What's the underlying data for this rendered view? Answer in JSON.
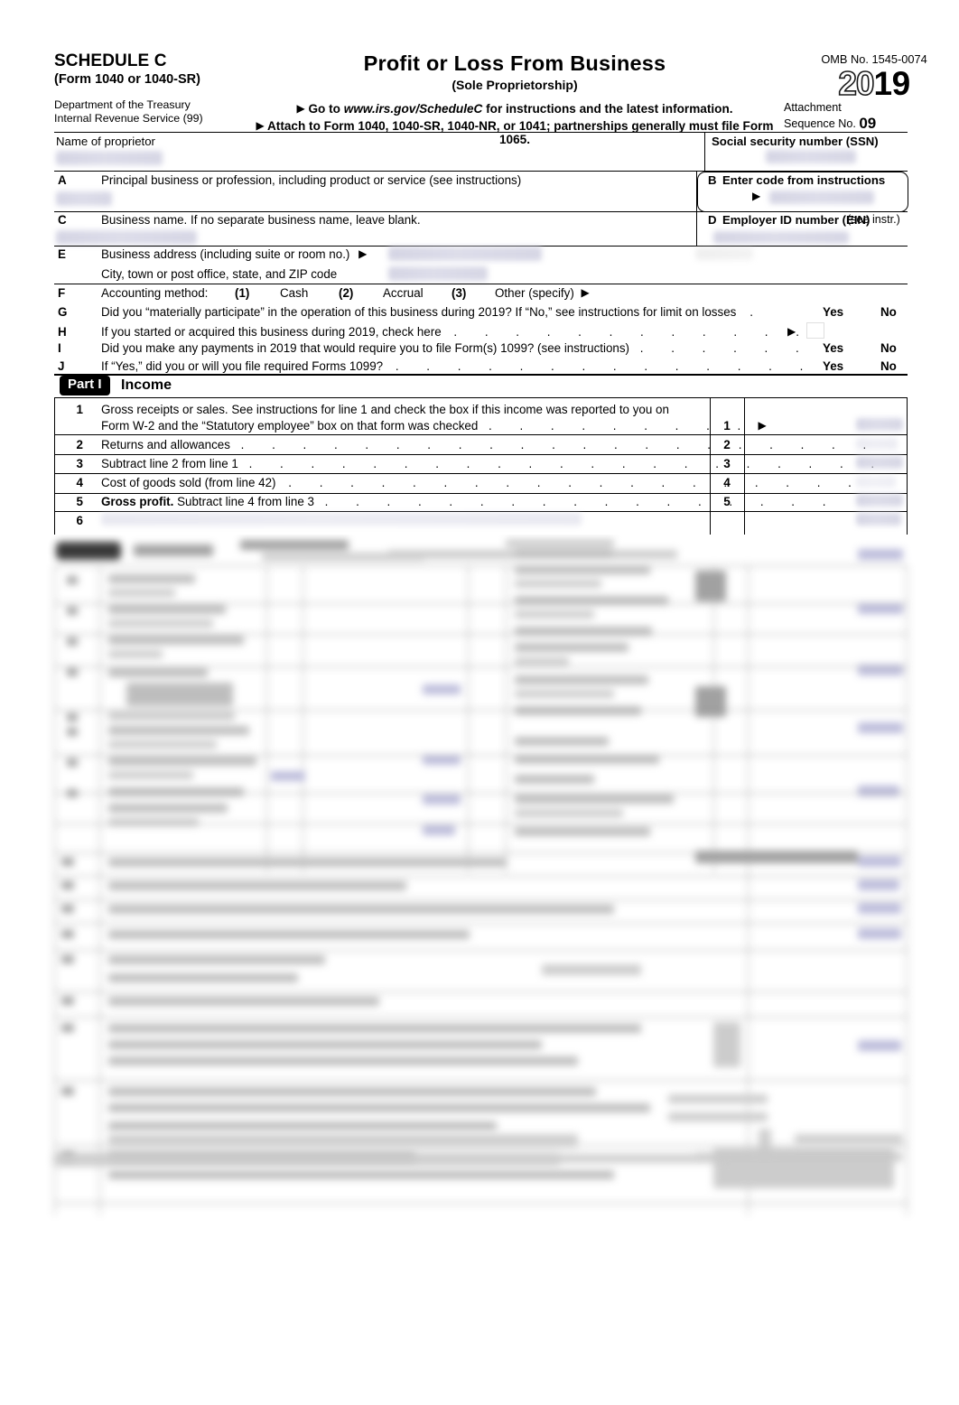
{
  "document": {
    "form_name": "SCHEDULE C",
    "form_parenthetical": "(Form 1040 or 1040-SR)",
    "department_line1": "Department of the Treasury",
    "department_line2": "Internal Revenue Service (99)",
    "title": "Profit or Loss From Business",
    "subtitle": "(Sole Proprietorship)",
    "goto_prefix": "Go to",
    "goto_url": "www.irs.gov/ScheduleC",
    "goto_suffix": "for instructions and the latest information.",
    "attach_line": "Attach to Form 1040, 1040-SR, 1040-NR, or 1041; partnerships generally must file Form 1065.",
    "omb": "OMB No. 1545-0074",
    "year_hollow": "20",
    "year_solid": "19",
    "attachment_label_line1": "Attachment",
    "attachment_label_line2": "Sequence No.",
    "sequence_no": "09",
    "triangle": "▶"
  },
  "identity": {
    "proprietor_label": "Name of proprietor",
    "ssn_label": "Social security number (SSN)",
    "proprietor_value": "",
    "ssn_value": ""
  },
  "lines": {
    "A": {
      "letter": "A",
      "text": "Principal business or profession, including product or service (see instructions)",
      "value": ""
    },
    "B": {
      "letter": "B",
      "text": "Enter code from instructions",
      "value": ""
    },
    "C": {
      "letter": "C",
      "text": "Business name. If no separate business name, leave blank.",
      "value": ""
    },
    "D": {
      "letter": "D",
      "text": "Employer ID number (EIN)",
      "text_small": "(see instr.)",
      "value": ""
    },
    "E": {
      "letter": "E",
      "text": "Business address (including suite or room no.)",
      "text_line2": "City, town or post office, state, and ZIP code",
      "value": "",
      "value_line2": ""
    },
    "F": {
      "letter": "F",
      "text": "Accounting method:",
      "opt1_num": "(1)",
      "opt1": "Cash",
      "opt2_num": "(2)",
      "opt2": "Accrual",
      "opt3_num": "(3)",
      "opt3": "Other (specify)"
    },
    "G": {
      "letter": "G",
      "text": "Did you “materially participate” in the operation of this business during 2019? If “No,” see instructions for limit on losses",
      "yes": "Yes",
      "no": "No"
    },
    "H": {
      "letter": "H",
      "text": "If you started or acquired this business during 2019, check here"
    },
    "I": {
      "letter": "I",
      "text": "Did you make any payments in 2019 that would require you to file Form(s) 1099? (see instructions)",
      "yes": "Yes",
      "no": "No"
    },
    "J": {
      "letter": "J",
      "text": "If “Yes,” did you or will you file required Forms 1099?",
      "yes": "Yes",
      "no": "No"
    }
  },
  "part1": {
    "badge": "Part I",
    "title": "Income",
    "rows": [
      {
        "no": "1",
        "text_line1": "Gross receipts or sales. See instructions for line 1 and check the box if this income was reported to you on",
        "text_line2": "Form W-2 and the “Statutory employee” box on that form was checked",
        "box_no": "1",
        "value": "",
        "bold_prefix": ""
      },
      {
        "no": "2",
        "text_line1": "Returns and allowances",
        "text_line2": "",
        "box_no": "2",
        "value": "",
        "bold_prefix": ""
      },
      {
        "no": "3",
        "text_line1": "Subtract line 2 from line 1",
        "text_line2": "",
        "box_no": "3",
        "value": "",
        "bold_prefix": ""
      },
      {
        "no": "4",
        "text_line1": "Cost of goods sold (from line 42)",
        "text_line2": "",
        "box_no": "4",
        "value": "",
        "bold_prefix": ""
      },
      {
        "no": "5",
        "text_line1": "Subtract line 4 from line 3",
        "text_line2": "",
        "box_no": "5",
        "value": "",
        "bold_prefix": "Gross profit."
      },
      {
        "no": "6",
        "text_line1": "",
        "text_line2": "",
        "box_no": "",
        "value": "",
        "bold_prefix": ""
      }
    ]
  },
  "obscured": {
    "note": "Lower portion of form is blurred and illegible",
    "region_label": ""
  },
  "colors": {
    "ink": "#000000",
    "badge_bg": "#000000",
    "badge_fg": "#ffffff",
    "redaction": "#cfcfe0",
    "rule": "#000000"
  }
}
